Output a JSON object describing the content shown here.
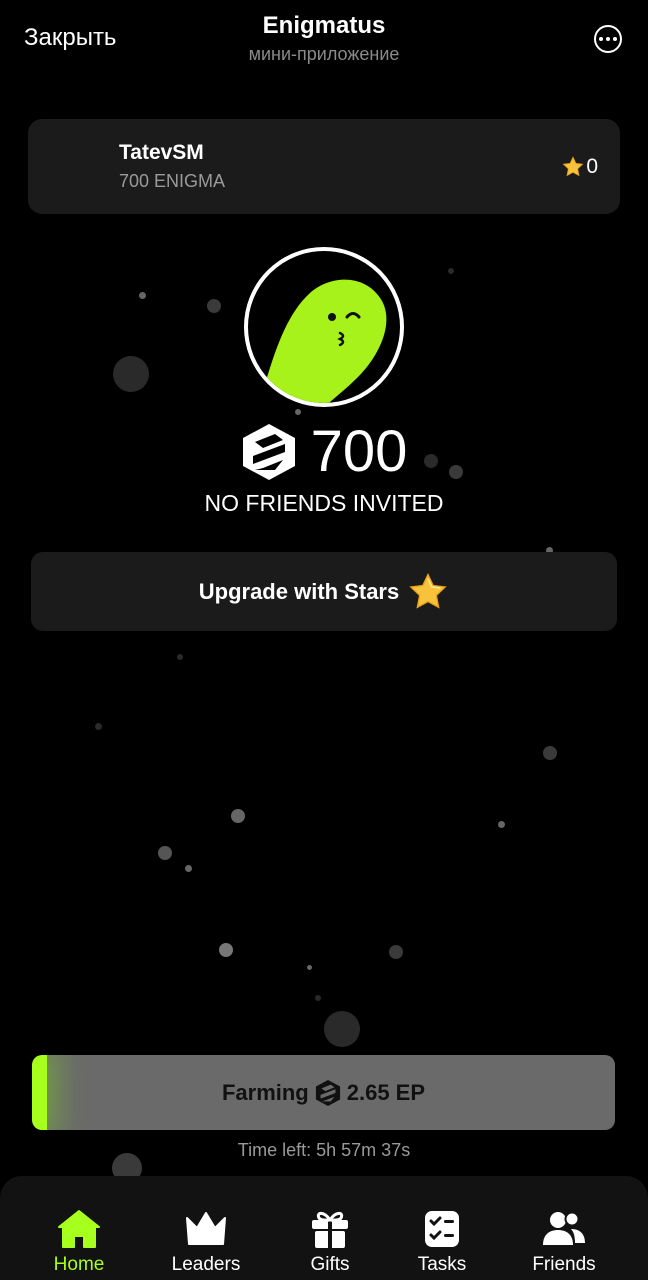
{
  "header": {
    "close_label": "Закрыть",
    "title": "Enigmatus",
    "subtitle": "мини-приложение"
  },
  "profile": {
    "username": "TatevSM",
    "balance_text": "700 ENIGMA",
    "stars": "0"
  },
  "avatar": {
    "icon": "green-ghost-winking"
  },
  "score": {
    "value": "700",
    "icon": "enigma-logo-icon"
  },
  "friends_status": "NO FRIENDS INVITED",
  "upgrade": {
    "label": "Upgrade with Stars",
    "icon": "star-icon"
  },
  "farming": {
    "label": "Farming",
    "rate": "2.65 EP",
    "progress": 0.025,
    "time_left": "Time left: 5h 57m 37s"
  },
  "nav": {
    "items": [
      {
        "label": "Home",
        "icon": "home-icon",
        "active": true
      },
      {
        "label": "Leaders",
        "icon": "crown-icon",
        "active": false
      },
      {
        "label": "Gifts",
        "icon": "gift-icon",
        "active": false
      },
      {
        "label": "Tasks",
        "icon": "tasks-icon",
        "active": false
      },
      {
        "label": "Friends",
        "icon": "friends-icon",
        "active": false
      }
    ]
  },
  "colors": {
    "accent": "#a6ff1c",
    "background": "#000000",
    "card": "#1b1b1b"
  }
}
